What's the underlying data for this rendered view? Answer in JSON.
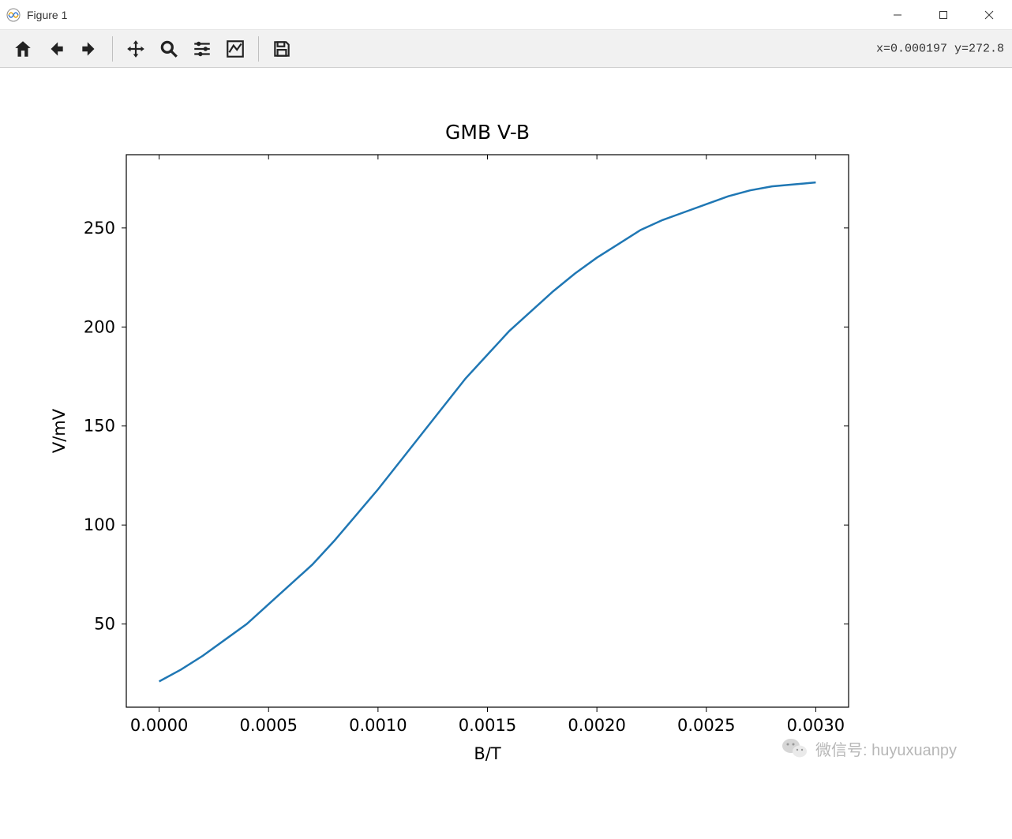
{
  "window": {
    "title": "Figure 1"
  },
  "toolbar": {
    "coord_readout": "x=0.000197 y=272.8"
  },
  "watermark": {
    "text": "微信号: huyuxuanpy"
  },
  "chart_data": {
    "type": "line",
    "title": "GMB V-B",
    "xlabel": "B/T",
    "ylabel": "V/mV",
    "x": [
      0.0,
      0.0001,
      0.0002,
      0.0003,
      0.0004,
      0.0005,
      0.0006,
      0.0007,
      0.0008,
      0.0009,
      0.001,
      0.0011,
      0.0012,
      0.0013,
      0.0014,
      0.0015,
      0.0016,
      0.0017,
      0.0018,
      0.0019,
      0.002,
      0.0021,
      0.0022,
      0.0023,
      0.0024,
      0.0025,
      0.0026,
      0.0027,
      0.0028,
      0.0029,
      0.003
    ],
    "y": [
      21,
      27,
      34,
      42,
      50,
      60,
      70,
      80,
      92,
      105,
      118,
      132,
      146,
      160,
      174,
      186,
      198,
      208,
      218,
      227,
      235,
      242,
      249,
      254,
      258,
      262,
      266,
      269,
      271,
      272,
      273
    ],
    "xlim": [
      -0.00015,
      0.00315
    ],
    "ylim": [
      8,
      287
    ],
    "xticks": [
      0.0,
      0.0005,
      0.001,
      0.0015,
      0.002,
      0.0025,
      0.003
    ],
    "xtick_labels": [
      "0.0000",
      "0.0005",
      "0.0010",
      "0.0015",
      "0.0020",
      "0.0025",
      "0.0030"
    ],
    "yticks": [
      50,
      100,
      150,
      200,
      250
    ],
    "ytick_labels": [
      "50",
      "100",
      "150",
      "200",
      "250"
    ],
    "line_color": "#1f77b4"
  }
}
